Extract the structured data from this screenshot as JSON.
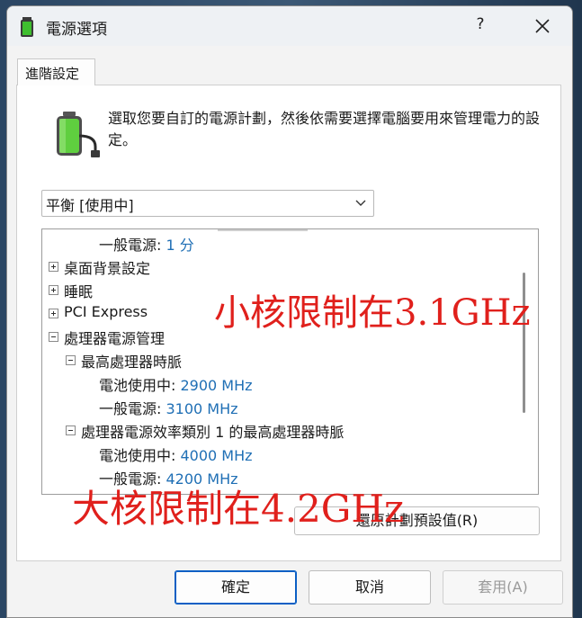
{
  "window": {
    "title": "電源選項",
    "help_label": "?",
    "icons": {
      "app": "power-options-icon",
      "close": "close-icon",
      "help": "help-icon"
    }
  },
  "tab": {
    "label": "進階設定"
  },
  "description": "選取您要自訂的電源計劃，然後依需要選擇電腦要用來管理電力的設定。",
  "plan_select": {
    "value": "平衡 [使用中]"
  },
  "tree": {
    "rows": [
      {
        "label": "一般電源:",
        "value": "1 分"
      },
      {
        "label": "桌面背景設定"
      },
      {
        "label": "睡眠"
      },
      {
        "label": "PCI Express"
      },
      {
        "label": "處理器電源管理"
      },
      {
        "label": "最高處理器時脈"
      },
      {
        "label": "電池使用中:",
        "value": "2900 MHz"
      },
      {
        "label": "一般電源:",
        "value": "3100 MHz"
      },
      {
        "label": "處理器電源效率類別 1 的最高處理器時脈"
      },
      {
        "label": "電池使用中:",
        "value": "4000 MHz"
      },
      {
        "label": "一般電源:",
        "value": "4200 MHz"
      }
    ]
  },
  "restore_button": "還原計劃預設值(R)",
  "annotations": {
    "small_core": "小核限制在3.1GHz",
    "big_core": "大核限制在4.2GHz",
    "color": "#e0201c"
  },
  "buttons": {
    "ok": "確定",
    "cancel": "取消",
    "apply": "套用(A)"
  },
  "accent_color": "#0b5fc4"
}
